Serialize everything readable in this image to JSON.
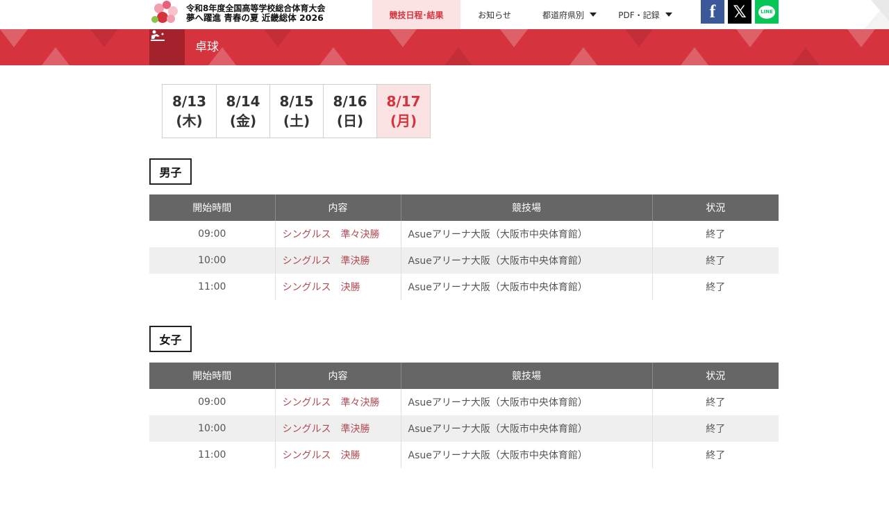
{
  "header": {
    "logo_line1": "令和8年度全国高等学校総合体育大会",
    "logo_line2": "夢へ躍進 青春の夏 近畿総体 2026",
    "nav": [
      {
        "label": "競技日程･結果",
        "active": true,
        "dropdown": false
      },
      {
        "label": "お知らせ",
        "active": false,
        "dropdown": false
      },
      {
        "label": "都道府県別",
        "active": false,
        "dropdown": true
      },
      {
        "label": "PDF・記録",
        "active": false,
        "dropdown": true
      }
    ],
    "social": {
      "facebook": "f",
      "x": "𝕏",
      "line": "LINE"
    }
  },
  "banner": {
    "title": "卓球",
    "icon": "table-tennis-icon"
  },
  "dates": [
    {
      "date": "8/13",
      "day": "(木)",
      "active": false
    },
    {
      "date": "8/14",
      "day": "(金)",
      "active": false
    },
    {
      "date": "8/15",
      "day": "(土)",
      "active": false
    },
    {
      "date": "8/16",
      "day": "(日)",
      "active": false
    },
    {
      "date": "8/17",
      "day": "(月)",
      "active": true
    }
  ],
  "table_headers": {
    "time": "開始時間",
    "event": "内容",
    "venue": "競技場",
    "status": "状況"
  },
  "sections": [
    {
      "label": "男子",
      "rows": [
        {
          "time": "09:00",
          "event": "シングルス　準々決勝",
          "venue": "Asueアリーナ大阪（大阪市中央体育館）",
          "status": "終了"
        },
        {
          "time": "10:00",
          "event": "シングルス　準決勝",
          "venue": "Asueアリーナ大阪（大阪市中央体育館）",
          "status": "終了"
        },
        {
          "time": "11:00",
          "event": "シングルス　決勝",
          "venue": "Asueアリーナ大阪（大阪市中央体育館）",
          "status": "終了"
        }
      ]
    },
    {
      "label": "女子",
      "rows": [
        {
          "time": "09:00",
          "event": "シングルス　準々決勝",
          "venue": "Asueアリーナ大阪（大阪市中央体育館）",
          "status": "終了"
        },
        {
          "time": "10:00",
          "event": "シングルス　準決勝",
          "venue": "Asueアリーナ大阪（大阪市中央体育館）",
          "status": "終了"
        },
        {
          "time": "11:00",
          "event": "シングルス　決勝",
          "venue": "Asueアリーナ大阪（大阪市中央体育館）",
          "status": "終了"
        }
      ]
    }
  ],
  "colors": {
    "accent": "#d5343f",
    "accent_light": "#fbe3e3",
    "table_header": "#666666",
    "row_alt": "#efefef",
    "link": "#b04a52"
  }
}
